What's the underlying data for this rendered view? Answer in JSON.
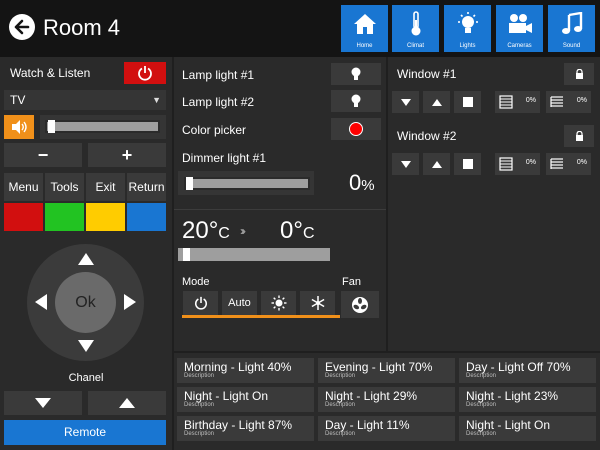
{
  "header": {
    "title": "Room 4",
    "nav": [
      {
        "label": "Home",
        "icon": "home-icon"
      },
      {
        "label": "Climat",
        "icon": "thermometer-icon"
      },
      {
        "label": "Lights",
        "icon": "lightbulb-icon"
      },
      {
        "label": "Cameras",
        "icon": "camera-icon"
      },
      {
        "label": "Sound",
        "icon": "music-icon"
      }
    ],
    "accent": "#1976d2"
  },
  "media": {
    "title": "Watch & Listen",
    "source": "TV",
    "volume_fraction": 0.0,
    "minus_label": "−",
    "plus_label": "+",
    "buttons": [
      "Menu",
      "Tools",
      "Exit",
      "Return"
    ],
    "color_keys": [
      "#d20f0f",
      "#22c322",
      "#ffcc00",
      "#1976d2"
    ],
    "ok_label": "Ok",
    "chanel_label": "Chanel",
    "remote_label": "Remote"
  },
  "lights": {
    "items": [
      {
        "label": "Lamp light #1",
        "icon": "lightbulb-icon"
      },
      {
        "label": "Lamp light #2",
        "icon": "lightbulb-icon"
      },
      {
        "label": "Color picker",
        "color": "#ff0000"
      }
    ],
    "dimmer_label": "Dimmer light #1",
    "dimmer_value": "0",
    "dimmer_unit": "%"
  },
  "climate": {
    "current": "20°",
    "current_unit": "C",
    "target": "0°",
    "target_unit": "C",
    "mode_label": "Mode",
    "fan_label": "Fan",
    "modes": [
      "power",
      "Auto",
      "sun",
      "snowflake"
    ],
    "mode_accent": "#f0901a"
  },
  "windows": [
    {
      "label": "Window #1",
      "pct_a": "0%",
      "pct_b": "0%"
    },
    {
      "label": "Window #2",
      "pct_a": "0%",
      "pct_b": "0%"
    }
  ],
  "scenes": [
    {
      "title": "Morning - Light 40%",
      "desc": "Description"
    },
    {
      "title": "Evening - Light 70%",
      "desc": "Description"
    },
    {
      "title": "Day - Light Off 70%",
      "desc": "Description"
    },
    {
      "title": "Night - Light On",
      "desc": "Description"
    },
    {
      "title": "Night - Light 29%",
      "desc": "Description"
    },
    {
      "title": "Night - Light 23%",
      "desc": "Description"
    },
    {
      "title": "Birthday - Light 87%",
      "desc": "Description"
    },
    {
      "title": "Day - Light 11%",
      "desc": "Description"
    },
    {
      "title": "Night - Light On",
      "desc": "Description"
    }
  ]
}
